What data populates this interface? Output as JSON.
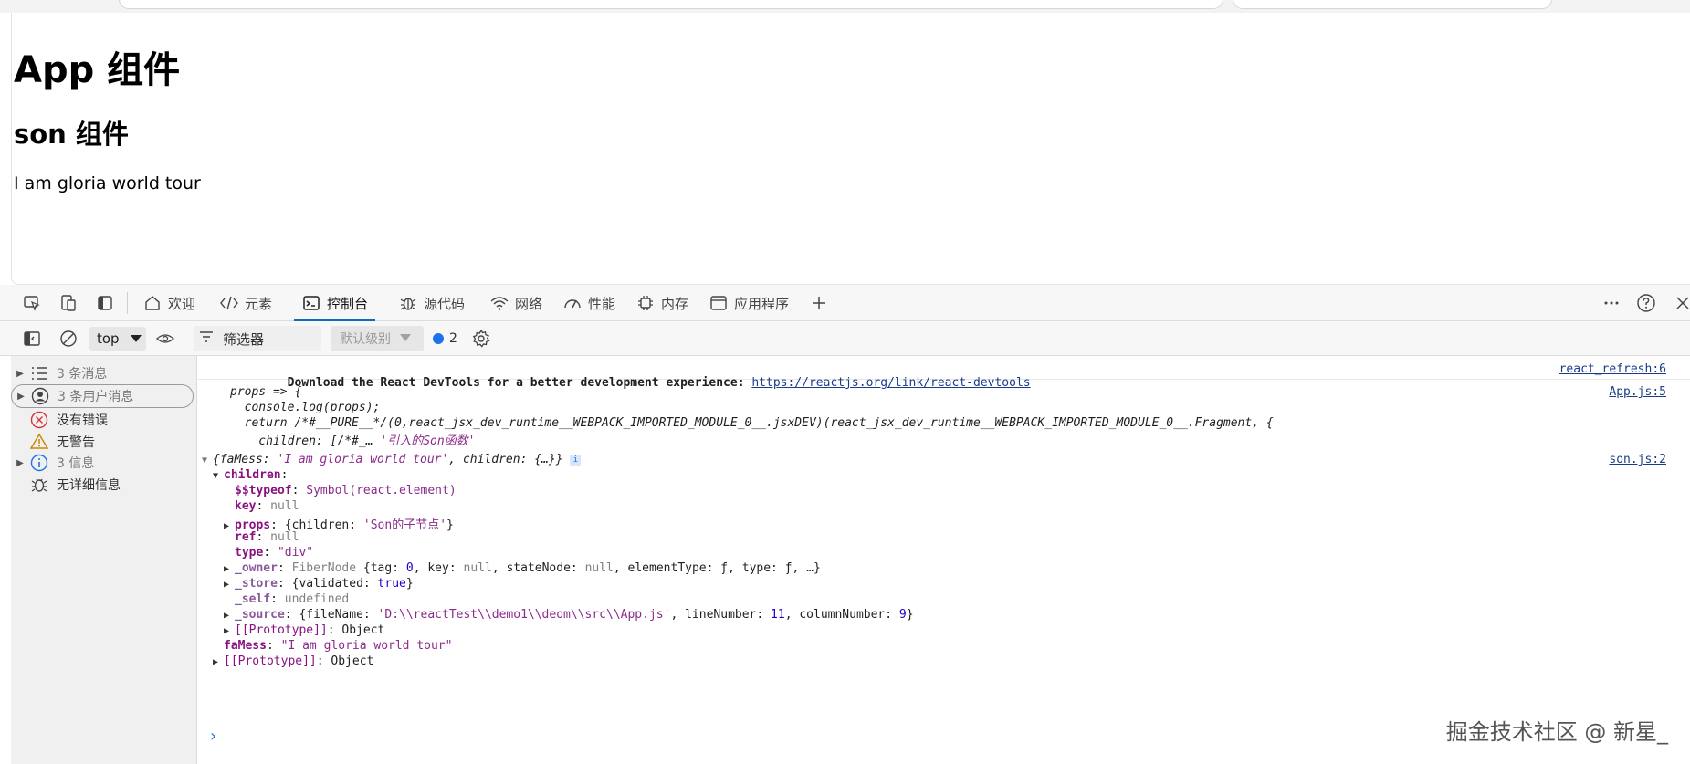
{
  "page": {
    "heading1": "App 组件",
    "heading2": "son 组件",
    "paragraph": "I am gloria world tour"
  },
  "devtools": {
    "tabs": [
      {
        "label": "欢迎",
        "icon": "home-icon"
      },
      {
        "label": "元素",
        "icon": "code-icon"
      },
      {
        "label": "控制台",
        "icon": "console-icon",
        "active": true
      },
      {
        "label": "源代码",
        "icon": "bug-icon"
      },
      {
        "label": "网络",
        "icon": "wifi-icon"
      },
      {
        "label": "性能",
        "icon": "gauge-icon"
      },
      {
        "label": "内存",
        "icon": "chip-icon"
      },
      {
        "label": "应用程序",
        "icon": "app-window-icon"
      }
    ],
    "toolbar": {
      "context": "top",
      "filter_label": "筛选器",
      "levels_label": "默认级别",
      "issues_count": "2"
    },
    "sidebar": [
      {
        "label": "3 条消息",
        "icon": "list-icon"
      },
      {
        "label": "3 条用户消息",
        "icon": "user-icon"
      },
      {
        "label": "没有错误",
        "icon": "error-icon"
      },
      {
        "label": "无警告",
        "icon": "warning-icon"
      },
      {
        "label": "3 信息",
        "icon": "info-icon"
      },
      {
        "label": "无详细信息",
        "icon": "bug-icon"
      }
    ],
    "console": {
      "msg1": {
        "text": "Download the React DevTools for a better development experience: ",
        "link": "https://reactjs.org/link/react-devtools",
        "source": "react_refresh:6"
      },
      "msg2": {
        "line1": "props => {",
        "line2": "  console.log(props);",
        "line3": "  return /*#__PURE__*/(0,react_jsx_dev_runtime__WEBPACK_IMPORTED_MODULE_0__.jsxDEV)(react_jsx_dev_runtime__WEBPACK_IMPORTED_MODULE_0__.Fragment, {",
        "line4a": "    children: [/*#_… ",
        "line4b": "'引入的Son函数'",
        "source": "App.js:5"
      },
      "msg3": {
        "summary_open": "{faMess: ",
        "summary_str": "'I am gloria world tour'",
        "summary_rest": ", children: {…}}",
        "source": "son.js:2",
        "children_key": "children",
        "typeof_key": "$$typeof",
        "typeof_val": "Symbol(react.element)",
        "key_key": "key",
        "key_val": "null",
        "props_key": "props",
        "props_open": "{children: ",
        "props_str": "'Son的子节点'",
        "props_close": "}",
        "ref_key": "ref",
        "ref_val": "null",
        "type_key": "type",
        "type_val": "\"div\"",
        "owner_key": "_owner",
        "owner_class": "FiberNode",
        "owner_a": " {tag: ",
        "owner_tag": "0",
        "owner_b": ", key: ",
        "owner_keyval": "null",
        "owner_c": ", stateNode: ",
        "owner_sn": "null",
        "owner_d": ", elementType: ƒ, type: ƒ, …}",
        "store_key": "_store",
        "store_a": "{validated: ",
        "store_val": "true",
        "store_b": "}",
        "self_key": "_self",
        "self_val": "undefined",
        "source_key": "_source",
        "source_a": "{fileName: ",
        "source_file": "'D:\\\\reactTest\\\\demo1\\\\deom\\\\src\\\\App.js'",
        "source_b": ", lineNumber: ",
        "source_line": "11",
        "source_c": ", columnNumber: ",
        "source_col": "9",
        "source_d": "}",
        "proto_inner_key": "[[Prototype]]",
        "proto_inner_val": "Object",
        "famess_key": "faMess",
        "famess_val": "\"I am gloria world tour\"",
        "proto_outer_key": "[[Prototype]]",
        "proto_outer_val": "Object"
      }
    }
  },
  "watermark": "掘金技术社区 @ 新星_"
}
